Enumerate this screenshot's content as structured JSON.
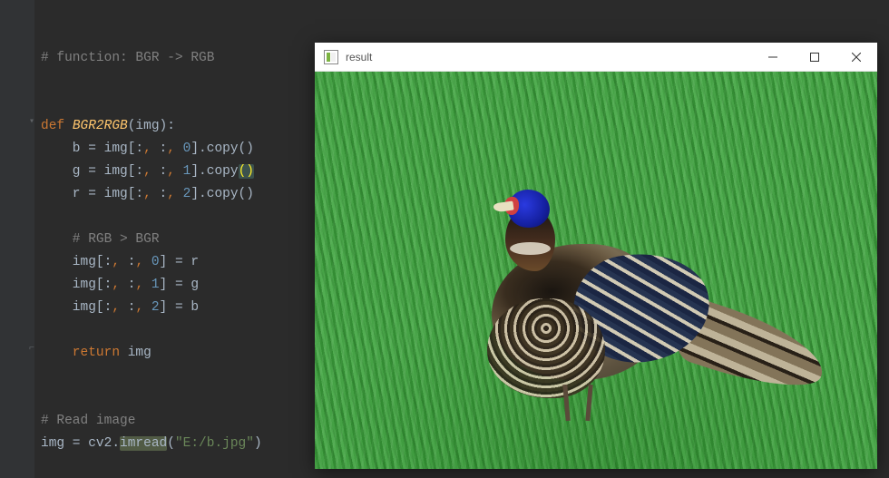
{
  "code": {
    "l1_comment": "# function: BGR -> RGB",
    "l2_def": "def ",
    "l2_fn": "BGR2RGB",
    "l2_open": "(img)",
    "l2_colon": ":",
    "l3_pre": "    b = img[",
    "l3_colon1": ":",
    "l3_sep1": ", ",
    "l3_colon2": ":",
    "l3_sep2": ", ",
    "l3_num": "0",
    "l3_post": "].copy()",
    "l4_pre": "    g = img[",
    "l4_colon1": ":",
    "l4_sep1": ", ",
    "l4_colon2": ":",
    "l4_sep2": ", ",
    "l4_num": "1",
    "l4_post": "].copy",
    "l4_paren": "()",
    "l5_pre": "    r = img[",
    "l5_colon1": ":",
    "l5_sep1": ", ",
    "l5_colon2": ":",
    "l5_sep2": ", ",
    "l5_num": "2",
    "l5_post": "].copy()",
    "l6_comment": "    # RGB > BGR",
    "l7_pre": "    img[",
    "l7_c1": ":",
    "l7_s1": ", ",
    "l7_c2": ":",
    "l7_s2": ", ",
    "l7_num": "0",
    "l7_post": "] = r",
    "l8_pre": "    img[",
    "l8_c1": ":",
    "l8_s1": ", ",
    "l8_c2": ":",
    "l8_s2": ", ",
    "l8_num": "1",
    "l8_post": "] = g",
    "l9_pre": "    img[",
    "l9_c1": ":",
    "l9_s1": ", ",
    "l9_c2": ":",
    "l9_s2": ", ",
    "l9_num": "2",
    "l9_post": "] = b",
    "l10_kw": "    return ",
    "l10_var": "img",
    "l11_comment": "# Read image",
    "l12_pre": "img = cv2.",
    "l12_fn": "imread",
    "l12_open": "(",
    "l12_str": "\"E:/b.jpg\"",
    "l12_close": ")"
  },
  "window": {
    "title": "result"
  }
}
